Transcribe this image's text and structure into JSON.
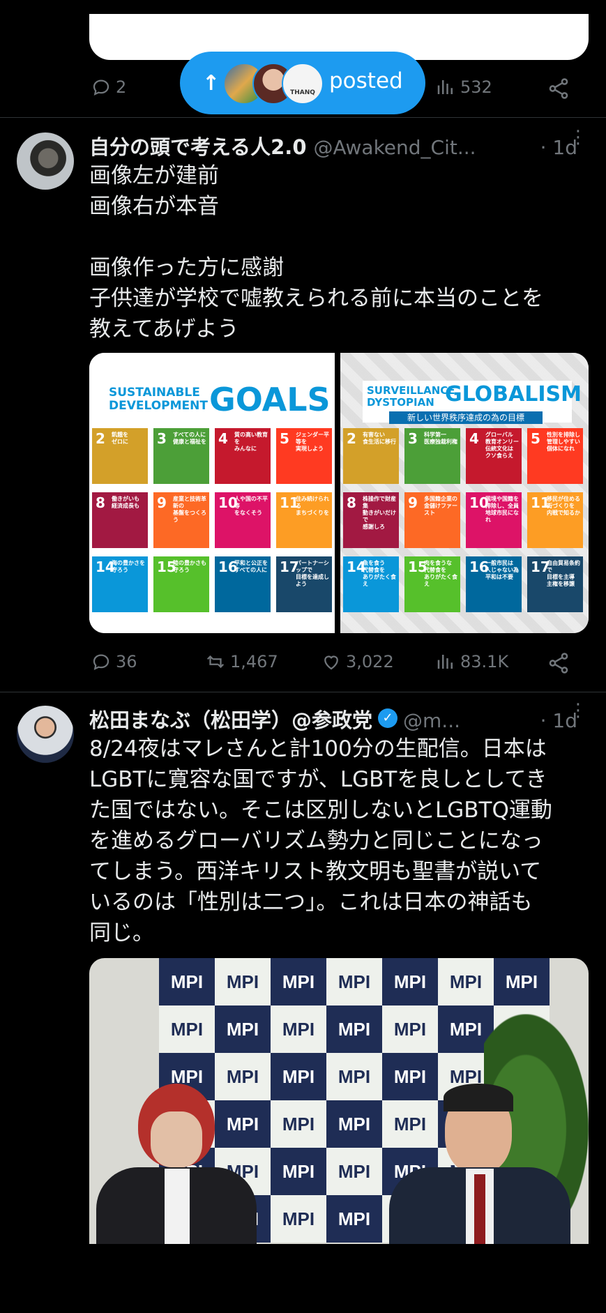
{
  "prev_post": {
    "replies": "2",
    "views": "532"
  },
  "new_posts_pill": {
    "label": "posted",
    "avatar3_text": "THANQ"
  },
  "post1": {
    "name": "自分の頭で考える人2.0",
    "handle": "@Awakend_Cit...",
    "time": "· 1d",
    "text": "画像左が建前\n画像右が本音\n\n画像作った方に感謝\n子供達が学校で嘘教えられる前に本当のことを\n教えてあげよう",
    "left_image": {
      "title_small_1": "SUSTAINABLE",
      "title_small_2": "DEVELOPMENT",
      "title_big": "GOALS",
      "tiles": [
        {
          "n": "2",
          "label": "飢餓を\nゼロに",
          "color": "#d3a029"
        },
        {
          "n": "3",
          "label": "すべての人に\n健康と福祉を",
          "color": "#4c9f38"
        },
        {
          "n": "4",
          "label": "質の高い教育を\nみんなに",
          "color": "#c5192d"
        },
        {
          "n": "5",
          "label": "ジェンダー平等を\n実現しよう",
          "color": "#ff3a21"
        },
        {
          "n": "8",
          "label": "働きがいも\n経済成長も",
          "color": "#a21942"
        },
        {
          "n": "9",
          "label": "産業と技術革新の\n基盤をつくろう",
          "color": "#fd6925"
        },
        {
          "n": "10",
          "label": "人や国の不平等\nをなくそう",
          "color": "#dd1367"
        },
        {
          "n": "11",
          "label": "住み続けられる\nまちづくりを",
          "color": "#fd9d24"
        },
        {
          "n": "14",
          "label": "海の豊かさを\n守ろう",
          "color": "#0a97d9"
        },
        {
          "n": "15",
          "label": "陸の豊かさも\n守ろう",
          "color": "#56c02b"
        },
        {
          "n": "16",
          "label": "平和と公正を\nすべての人に",
          "color": "#00689d"
        },
        {
          "n": "17",
          "label": "パートナーシップで\n目標を達成しよう",
          "color": "#19486a"
        }
      ]
    },
    "right_image": {
      "title_small_1": "SURVEILLANCE",
      "title_small_2": "DYSTOPIAN",
      "title_big": "GLOBALISM",
      "subtitle": "新しい世界秩序達成の為の目標",
      "tiles": [
        {
          "n": "2",
          "label": "有害ない\n食生活に移行",
          "color": "#d3a029"
        },
        {
          "n": "3",
          "label": "科学第一\n医療独裁利権",
          "color": "#4c9f38"
        },
        {
          "n": "4",
          "label": "グローバル\n教育オンリー\n伝統文化は\nクソ食らえ",
          "color": "#c5192d"
        },
        {
          "n": "5",
          "label": "性別を排除し\n管理しやすい\n個体になれ",
          "color": "#ff3a21"
        },
        {
          "n": "8",
          "label": "株操作で財産集\n動きがいだけで\n感謝しろ",
          "color": "#a21942"
        },
        {
          "n": "9",
          "label": "多国籍企業の\n金儲けファースト",
          "color": "#fd6925"
        },
        {
          "n": "10",
          "label": "国境や国籍を\n排除し、全員\n地球市民になれ",
          "color": "#dd1367"
        },
        {
          "n": "11",
          "label": "移民が住める\n街づくりを\n内戦で知るか",
          "color": "#fd9d24"
        },
        {
          "n": "14",
          "label": "魚を食う\n代替食を\nありがたく食え",
          "color": "#0a97d9"
        },
        {
          "n": "15",
          "label": "肉を食うな\n代替食を\nありがたく食え",
          "color": "#56c02b"
        },
        {
          "n": "16",
          "label": "一般市民は\n人じゃない為\n平和は不要",
          "color": "#00689d"
        },
        {
          "n": "17",
          "label": "自由貿易条約で\n目標を主導\n主権を移譲",
          "color": "#19486a"
        }
      ]
    },
    "replies": "36",
    "reposts": "1,467",
    "likes": "3,022",
    "views": "83.1K"
  },
  "post2": {
    "name": "松田まなぶ（松田学）@参政党",
    "handle": "@m...",
    "time": "· 1d",
    "text": "8/24夜はマレさんと計100分の生配信。日本は\nLGBTに寛容な国ですが、LGBTを良しとしてき\nた国ではない。そこは区別しないとLGBTQ運動\nを進めるグローバリズム勢力と同じことになっ\nてしまう。西洋キリスト教文明も聖書が説いて\nいるのは「性別は二つ」。これは日本の神話も\n同じ。",
    "backdrop_logo": "MPI"
  },
  "colors": {
    "accent": "#1d9bf0",
    "verified": "#1d9bf0",
    "muted": "#71767b",
    "divider": "#2f3336"
  }
}
